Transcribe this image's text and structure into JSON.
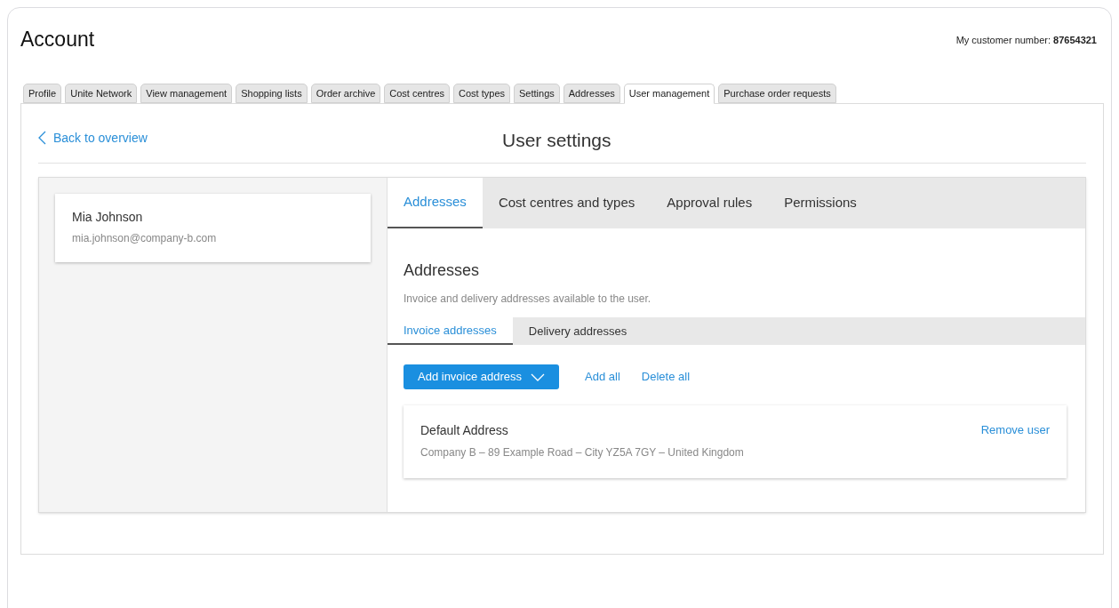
{
  "page": {
    "title": "Account",
    "customer_number": "My customer number: **87654321**"
  },
  "tabs": [
    {
      "label": "Profile",
      "selected": false
    },
    {
      "label": "Unite Network",
      "selected": false
    },
    {
      "label": "View management",
      "selected": false
    },
    {
      "label": "Shopping lists",
      "selected": false
    },
    {
      "label": "Order archive",
      "selected": false
    },
    {
      "label": "Cost centres",
      "selected": false
    },
    {
      "label": "Cost types",
      "selected": false
    },
    {
      "label": "Settings",
      "selected": false
    },
    {
      "label": "Addresses",
      "selected": false
    },
    {
      "label": "User management",
      "selected": true
    },
    {
      "label": "Purchase order requests",
      "selected": false
    }
  ],
  "back_link": "Back to overview",
  "heading": "User settings",
  "user": {
    "name": "Mia Johnson",
    "email": "mia.johnson@company-b.com"
  },
  "settings_tabs": [
    {
      "label": "Addresses",
      "selected": true
    },
    {
      "label": "Cost centres and types",
      "selected": false
    },
    {
      "label": "Approval rules",
      "selected": false
    },
    {
      "label": "Permissions",
      "selected": false
    }
  ],
  "section": {
    "title": "Addresses",
    "description": "Invoice and delivery addresses available to the user."
  },
  "address_tabs": [
    {
      "label": "Invoice addresses",
      "selected": true
    },
    {
      "label": "Delivery addresses",
      "selected": false
    }
  ],
  "actions": {
    "add_button": "Add invoice address",
    "add_all": "Add all",
    "delete_all": "Delete all"
  },
  "addresses": [
    {
      "name": "Default Address",
      "line": "Company B – 89 Example Road – City YZ5A 7GY – United Kingdom",
      "action": "Remove user"
    }
  ]
}
